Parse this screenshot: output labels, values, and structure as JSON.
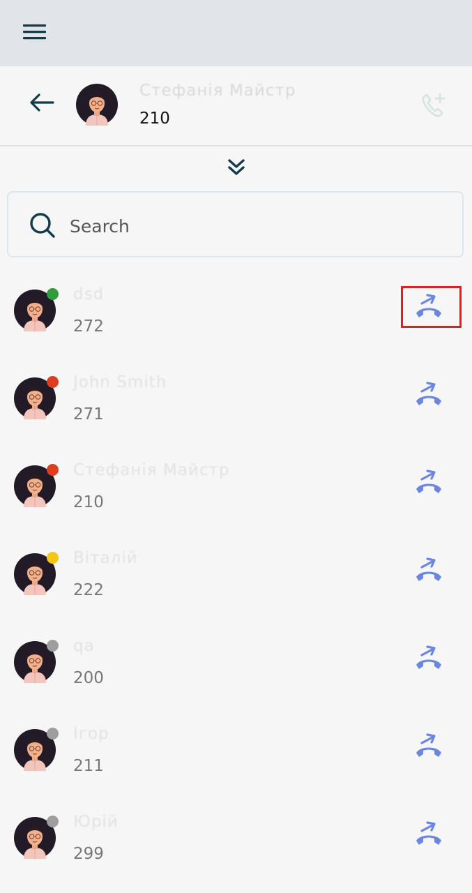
{
  "header": {
    "contact_name": "Стефанія Майстр",
    "extension": "210"
  },
  "search": {
    "placeholder": "Search",
    "value": ""
  },
  "contacts": [
    {
      "name": "dsd",
      "extension": "272",
      "status": "online",
      "status_color": "#2e9e3c"
    },
    {
      "name": "John Smith",
      "extension": "271",
      "status": "busy",
      "status_color": "#e03c1f"
    },
    {
      "name": "Стефанія Майстр",
      "extension": "210",
      "status": "busy",
      "status_color": "#e03c1f"
    },
    {
      "name": "Віталій",
      "extension": "222",
      "status": "away",
      "status_color": "#f5c518"
    },
    {
      "name": "qa",
      "extension": "200",
      "status": "offline",
      "status_color": "#9e9e9e"
    },
    {
      "name": "Ігор",
      "extension": "211",
      "status": "offline",
      "status_color": "#9e9e9e"
    },
    {
      "name": "Юрій",
      "extension": "299",
      "status": "offline",
      "status_color": "#9e9e9e"
    }
  ],
  "colors": {
    "accent": "#6b86e0",
    "dark": "#0f3b4a",
    "topbar": "#e1e5ea",
    "highlight": "#e02020"
  },
  "icons": [
    "menu-icon",
    "back-arrow-icon",
    "add-call-icon",
    "chevron-double-down-icon",
    "search-icon",
    "call-transfer-icon"
  ]
}
